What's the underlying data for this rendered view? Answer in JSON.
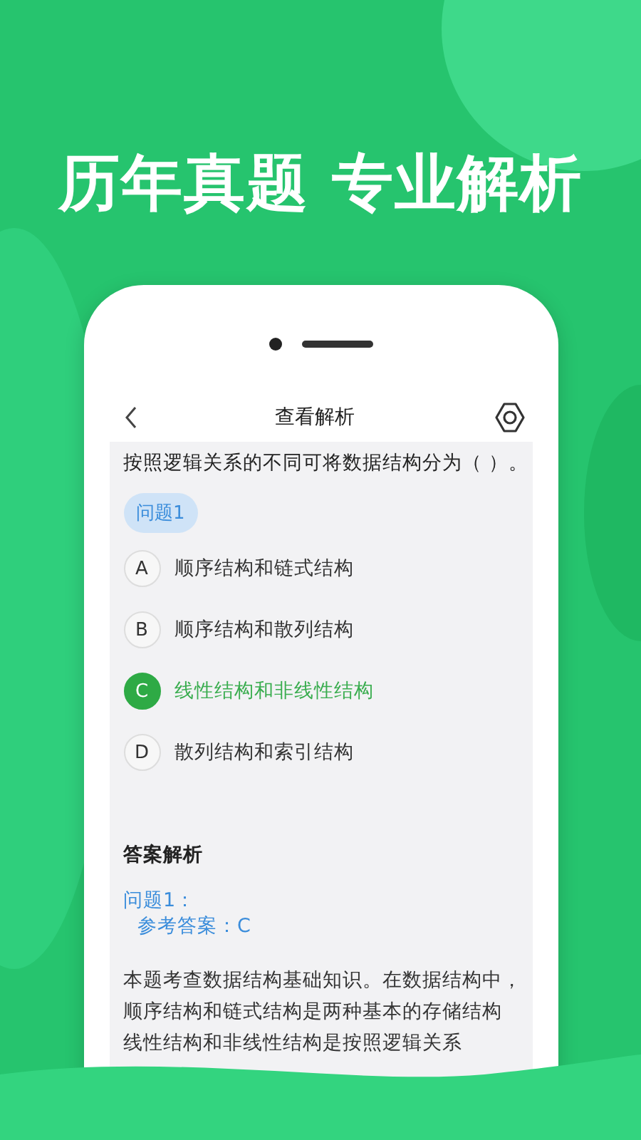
{
  "headline": "历年真题 专业解析",
  "nav": {
    "title": "查看解析"
  },
  "question": {
    "text": "按照逻辑关系的不同可将数据结构分为（   ）。",
    "tag": "问题1"
  },
  "options": [
    {
      "letter": "A",
      "text": "顺序结构和链式结构",
      "selected": false
    },
    {
      "letter": "B",
      "text": "顺序结构和散列结构",
      "selected": false
    },
    {
      "letter": "C",
      "text": "线性结构和非线性结构",
      "selected": true
    },
    {
      "letter": "D",
      "text": "散列结构和索引结构",
      "selected": false
    }
  ],
  "analysis": {
    "heading": "答案解析",
    "question_label": "问题1：",
    "answer": "参考答案：C",
    "lines": [
      "本题考查数据结构基础知识。在数据结构中，",
      "顺序结构和链式结构是两种基本的存储结构",
      "线性结构和非线性结构是按照逻辑关系"
    ]
  }
}
